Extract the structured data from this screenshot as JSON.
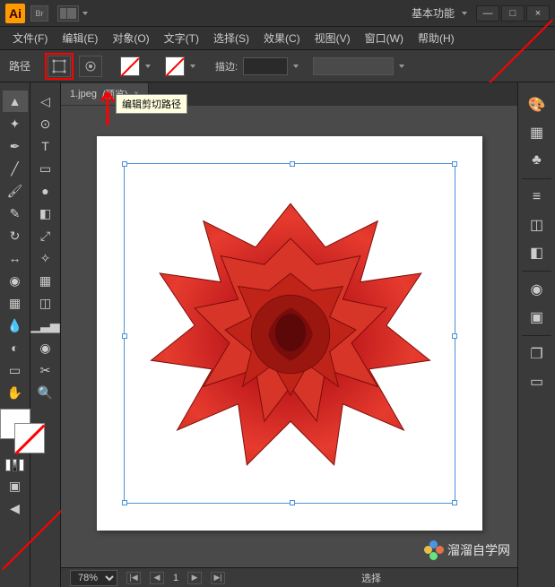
{
  "title": {
    "ai": "Ai",
    "br": "Br"
  },
  "workspace": {
    "label": "基本功能"
  },
  "window": {
    "min": "—",
    "max": "□",
    "close": "×"
  },
  "menu": {
    "file": "文件(F)",
    "edit": "编辑(E)",
    "object": "对象(O)",
    "type": "文字(T)",
    "select": "选择(S)",
    "effect": "效果(C)",
    "view": "视图(V)",
    "window": "窗口(W)",
    "help": "帮助(H)"
  },
  "options": {
    "label": "路径",
    "stroke": "描边:"
  },
  "tooltip": {
    "text": "编辑剪切路径"
  },
  "tab": {
    "name": "1.jpeg",
    "suffix": "/预览)",
    "close": "×"
  },
  "status": {
    "zoom": "78%",
    "page": "1",
    "tool": "选择"
  },
  "watermark": {
    "text": "溜溜自学网"
  }
}
